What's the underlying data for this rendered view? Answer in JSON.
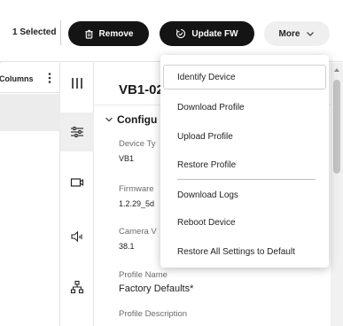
{
  "toolbar": {
    "selected_label": "1 Selected",
    "remove_label": "Remove",
    "update_fw_label": "Update FW",
    "more_label": "More"
  },
  "columns": {
    "label": "Columns"
  },
  "panel": {
    "device_title": "VB1-02",
    "section_title": "Configu",
    "fields": [
      {
        "label": "Device Ty",
        "value": "VB1"
      },
      {
        "label": "Firmware",
        "value": "1.2.29_5d"
      },
      {
        "label": "Camera V",
        "value": "38.1"
      },
      {
        "label": "Profile Name",
        "value": "Factory Defaults*"
      },
      {
        "label": "Profile Description",
        "value": ""
      }
    ]
  },
  "menu": {
    "items": [
      "Identify Device",
      "Download Profile",
      "Upload Profile",
      "Restore Profile",
      "Download Logs",
      "Reboot Device",
      "Restore All Settings to Default"
    ]
  },
  "colors": {
    "dark_button": "#141414",
    "more_button": "#efefef",
    "selected_row": "#ececec"
  }
}
